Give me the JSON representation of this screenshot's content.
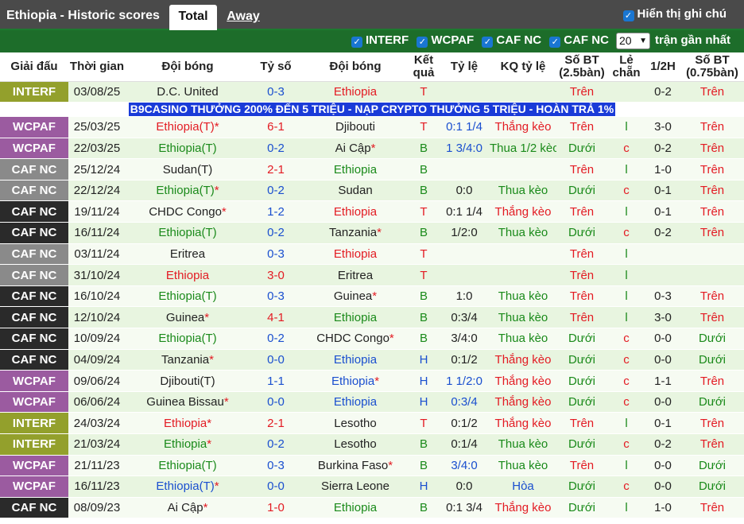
{
  "header": {
    "team_title": "Ethiopia - Historic scores",
    "tab_total": "Total",
    "tab_away": "Away",
    "show_notes": "Hiển thị ghi chú"
  },
  "filters": {
    "items": [
      "INTERF",
      "WCPAF",
      "CAF NC",
      "CAF NC"
    ],
    "count_value": "20",
    "recent_label": "trận gần nhất"
  },
  "columns": [
    "Giải đấu",
    "Thời gian",
    "Đội bóng",
    "Tỷ số",
    "Đội bóng",
    "Kết quả",
    "Tỷ lệ",
    "KQ tỷ lệ",
    "Số BT (2.5bàn)",
    "Lẻ chẵn",
    "1/2H",
    "Số BT (0.75bàn)"
  ],
  "promo": "B9CASINO THƯỞNG 200% ĐẾN 5 TRIỆU - NẠP CRYPTO THƯỞNG 5 TRIỆU - HOÀN TRẢ 1%",
  "colors": {
    "INTERF": "#93a02c",
    "WCPAF": "#9b5ba0",
    "CAF_NC_dark": "#2a2a2a",
    "CAF_NC_grey": "#8a8a8a",
    "win_red": "#e31b23",
    "home_green": "#1a8a1a",
    "score_blue": "#1a4fcf"
  },
  "rows": [
    {
      "league": "INTERF",
      "lc": "INTERF",
      "date": "03/08/25",
      "home": "D.C. United",
      "hc": "",
      "score": "0-3",
      "sc": "blue",
      "away": "Ethiopia",
      "ac": "red",
      "res": "T",
      "rc": "red",
      "odds": "",
      "oc": "",
      "kq": "",
      "kc": "",
      "bt": "Trên",
      "btc": "red",
      "lc2": "",
      "lcc": "",
      "h1": "0-2",
      "bt2": "Trên",
      "bt2c": "red"
    },
    {
      "league": "WCPAF",
      "lc": "WCPAF",
      "date": "25/03/25",
      "home": "Ethiopia(T)*",
      "hc": "red",
      "score": "6-1",
      "sc": "red",
      "away": "Djibouti",
      "ac": "",
      "res": "T",
      "rc": "red",
      "odds": "0:1 1/4",
      "oc": "blue",
      "kq": "Thắng kèo",
      "kc": "red",
      "bt": "Trên",
      "btc": "red",
      "lc2": "l",
      "lcc": "green",
      "h1": "3-0",
      "bt2": "Trên",
      "bt2c": "red"
    },
    {
      "league": "WCPAF",
      "lc": "WCPAF",
      "date": "22/03/25",
      "home": "Ethiopia(T)",
      "hc": "green",
      "score": "0-2",
      "sc": "blue",
      "away": "Ai Cập*",
      "ac": "",
      "res": "B",
      "rc": "green",
      "odds": "1 3/4:0",
      "oc": "blue",
      "kq": "Thua 1/2 kèo",
      "kc": "green",
      "bt": "Dưới",
      "btc": "green",
      "lc2": "c",
      "lcc": "red",
      "h1": "0-2",
      "bt2": "Trên",
      "bt2c": "red"
    },
    {
      "league": "CAF NC",
      "lc": "CAFNC-grey",
      "date": "25/12/24",
      "home": "Sudan(T)",
      "hc": "",
      "score": "2-1",
      "sc": "red",
      "away": "Ethiopia",
      "ac": "green",
      "res": "B",
      "rc": "green",
      "odds": "",
      "oc": "",
      "kq": "",
      "kc": "",
      "bt": "Trên",
      "btc": "red",
      "lc2": "l",
      "lcc": "green",
      "h1": "1-0",
      "bt2": "Trên",
      "bt2c": "red"
    },
    {
      "league": "CAF NC",
      "lc": "CAFNC-grey",
      "date": "22/12/24",
      "home": "Ethiopia(T)*",
      "hc": "green",
      "score": "0-2",
      "sc": "blue",
      "away": "Sudan",
      "ac": "",
      "res": "B",
      "rc": "green",
      "odds": "0:0",
      "oc": "",
      "kq": "Thua kèo",
      "kc": "green",
      "bt": "Dưới",
      "btc": "green",
      "lc2": "c",
      "lcc": "red",
      "h1": "0-1",
      "bt2": "Trên",
      "bt2c": "red"
    },
    {
      "league": "CAF NC",
      "lc": "CAFNC-dark",
      "date": "19/11/24",
      "home": "CHDC Congo*",
      "hc": "",
      "score": "1-2",
      "sc": "blue",
      "away": "Ethiopia",
      "ac": "red",
      "res": "T",
      "rc": "red",
      "odds": "0:1 1/4",
      "oc": "",
      "kq": "Thắng kèo",
      "kc": "red",
      "bt": "Trên",
      "btc": "red",
      "lc2": "l",
      "lcc": "green",
      "h1": "0-1",
      "bt2": "Trên",
      "bt2c": "red"
    },
    {
      "league": "CAF NC",
      "lc": "CAFNC-dark",
      "date": "16/11/24",
      "home": "Ethiopia(T)",
      "hc": "green",
      "score": "0-2",
      "sc": "blue",
      "away": "Tanzania*",
      "ac": "",
      "res": "B",
      "rc": "green",
      "odds": "1/2:0",
      "oc": "",
      "kq": "Thua kèo",
      "kc": "green",
      "bt": "Dưới",
      "btc": "green",
      "lc2": "c",
      "lcc": "red",
      "h1": "0-2",
      "bt2": "Trên",
      "bt2c": "red"
    },
    {
      "league": "CAF NC",
      "lc": "CAFNC-grey",
      "date": "03/11/24",
      "home": "Eritrea",
      "hc": "",
      "score": "0-3",
      "sc": "blue",
      "away": "Ethiopia",
      "ac": "red",
      "res": "T",
      "rc": "red",
      "odds": "",
      "oc": "",
      "kq": "",
      "kc": "",
      "bt": "Trên",
      "btc": "red",
      "lc2": "l",
      "lcc": "green",
      "h1": "",
      "bt2": "",
      "bt2c": ""
    },
    {
      "league": "CAF NC",
      "lc": "CAFNC-grey",
      "date": "31/10/24",
      "home": "Ethiopia",
      "hc": "red",
      "score": "3-0",
      "sc": "red",
      "away": "Eritrea",
      "ac": "",
      "res": "T",
      "rc": "red",
      "odds": "",
      "oc": "",
      "kq": "",
      "kc": "",
      "bt": "Trên",
      "btc": "red",
      "lc2": "l",
      "lcc": "green",
      "h1": "",
      "bt2": "",
      "bt2c": ""
    },
    {
      "league": "CAF NC",
      "lc": "CAFNC-dark",
      "date": "16/10/24",
      "home": "Ethiopia(T)",
      "hc": "green",
      "score": "0-3",
      "sc": "blue",
      "away": "Guinea*",
      "ac": "",
      "res": "B",
      "rc": "green",
      "odds": "1:0",
      "oc": "",
      "kq": "Thua kèo",
      "kc": "green",
      "bt": "Trên",
      "btc": "red",
      "lc2": "l",
      "lcc": "green",
      "h1": "0-3",
      "bt2": "Trên",
      "bt2c": "red"
    },
    {
      "league": "CAF NC",
      "lc": "CAFNC-dark",
      "date": "12/10/24",
      "home": "Guinea*",
      "hc": "",
      "score": "4-1",
      "sc": "red",
      "away": "Ethiopia",
      "ac": "green",
      "res": "B",
      "rc": "green",
      "odds": "0:3/4",
      "oc": "",
      "kq": "Thua kèo",
      "kc": "green",
      "bt": "Trên",
      "btc": "red",
      "lc2": "l",
      "lcc": "green",
      "h1": "3-0",
      "bt2": "Trên",
      "bt2c": "red"
    },
    {
      "league": "CAF NC",
      "lc": "CAFNC-dark",
      "date": "10/09/24",
      "home": "Ethiopia(T)",
      "hc": "green",
      "score": "0-2",
      "sc": "blue",
      "away": "CHDC Congo*",
      "ac": "",
      "res": "B",
      "rc": "green",
      "odds": "3/4:0",
      "oc": "",
      "kq": "Thua kèo",
      "kc": "green",
      "bt": "Dưới",
      "btc": "green",
      "lc2": "c",
      "lcc": "red",
      "h1": "0-0",
      "bt2": "Dưới",
      "bt2c": "green"
    },
    {
      "league": "CAF NC",
      "lc": "CAFNC-dark",
      "date": "04/09/24",
      "home": "Tanzania*",
      "hc": "",
      "score": "0-0",
      "sc": "blue",
      "away": "Ethiopia",
      "ac": "blue",
      "res": "H",
      "rc": "blue",
      "odds": "0:1/2",
      "oc": "",
      "kq": "Thắng kèo",
      "kc": "red",
      "bt": "Dưới",
      "btc": "green",
      "lc2": "c",
      "lcc": "red",
      "h1": "0-0",
      "bt2": "Dưới",
      "bt2c": "green"
    },
    {
      "league": "WCPAF",
      "lc": "WCPAF",
      "date": "09/06/24",
      "home": "Djibouti(T)",
      "hc": "",
      "score": "1-1",
      "sc": "blue",
      "away": "Ethiopia*",
      "ac": "blue",
      "res": "H",
      "rc": "blue",
      "odds": "1 1/2:0",
      "oc": "blue",
      "kq": "Thắng kèo",
      "kc": "red",
      "bt": "Dưới",
      "btc": "green",
      "lc2": "c",
      "lcc": "red",
      "h1": "1-1",
      "bt2": "Trên",
      "bt2c": "red"
    },
    {
      "league": "WCPAF",
      "lc": "WCPAF",
      "date": "06/06/24",
      "home": "Guinea Bissau*",
      "hc": "",
      "score": "0-0",
      "sc": "blue",
      "away": "Ethiopia",
      "ac": "blue",
      "res": "H",
      "rc": "blue",
      "odds": "0:3/4",
      "oc": "blue",
      "kq": "Thắng kèo",
      "kc": "red",
      "bt": "Dưới",
      "btc": "green",
      "lc2": "c",
      "lcc": "red",
      "h1": "0-0",
      "bt2": "Dưới",
      "bt2c": "green"
    },
    {
      "league": "INTERF",
      "lc": "INTERF",
      "date": "24/03/24",
      "home": "Ethiopia*",
      "hc": "red",
      "score": "2-1",
      "sc": "red",
      "away": "Lesotho",
      "ac": "",
      "res": "T",
      "rc": "red",
      "odds": "0:1/2",
      "oc": "",
      "kq": "Thắng kèo",
      "kc": "red",
      "bt": "Trên",
      "btc": "red",
      "lc2": "l",
      "lcc": "green",
      "h1": "0-1",
      "bt2": "Trên",
      "bt2c": "red"
    },
    {
      "league": "INTERF",
      "lc": "INTERF",
      "date": "21/03/24",
      "home": "Ethiopia*",
      "hc": "green",
      "score": "0-2",
      "sc": "blue",
      "away": "Lesotho",
      "ac": "",
      "res": "B",
      "rc": "green",
      "odds": "0:1/4",
      "oc": "",
      "kq": "Thua kèo",
      "kc": "green",
      "bt": "Dưới",
      "btc": "green",
      "lc2": "c",
      "lcc": "red",
      "h1": "0-2",
      "bt2": "Trên",
      "bt2c": "red"
    },
    {
      "league": "WCPAF",
      "lc": "WCPAF",
      "date": "21/11/23",
      "home": "Ethiopia(T)",
      "hc": "green",
      "score": "0-3",
      "sc": "blue",
      "away": "Burkina Faso*",
      "ac": "",
      "res": "B",
      "rc": "green",
      "odds": "3/4:0",
      "oc": "blue",
      "kq": "Thua kèo",
      "kc": "green",
      "bt": "Trên",
      "btc": "red",
      "lc2": "l",
      "lcc": "green",
      "h1": "0-0",
      "bt2": "Dưới",
      "bt2c": "green"
    },
    {
      "league": "WCPAF",
      "lc": "WCPAF",
      "date": "16/11/23",
      "home": "Ethiopia(T)*",
      "hc": "blue",
      "score": "0-0",
      "sc": "blue",
      "away": "Sierra Leone",
      "ac": "",
      "res": "H",
      "rc": "blue",
      "odds": "0:0",
      "oc": "",
      "kq": "Hòa",
      "kc": "blue",
      "bt": "Dưới",
      "btc": "green",
      "lc2": "c",
      "lcc": "red",
      "h1": "0-0",
      "bt2": "Dưới",
      "bt2c": "green"
    },
    {
      "league": "CAF NC",
      "lc": "CAFNC-dark",
      "date": "08/09/23",
      "home": "Ai Cập*",
      "hc": "",
      "score": "1-0",
      "sc": "red",
      "away": "Ethiopia",
      "ac": "green",
      "res": "B",
      "rc": "green",
      "odds": "0:1 3/4",
      "oc": "",
      "kq": "Thắng kèo",
      "kc": "red",
      "bt": "Dưới",
      "btc": "green",
      "lc2": "l",
      "lcc": "green",
      "h1": "1-0",
      "bt2": "Trên",
      "bt2c": "red"
    }
  ]
}
